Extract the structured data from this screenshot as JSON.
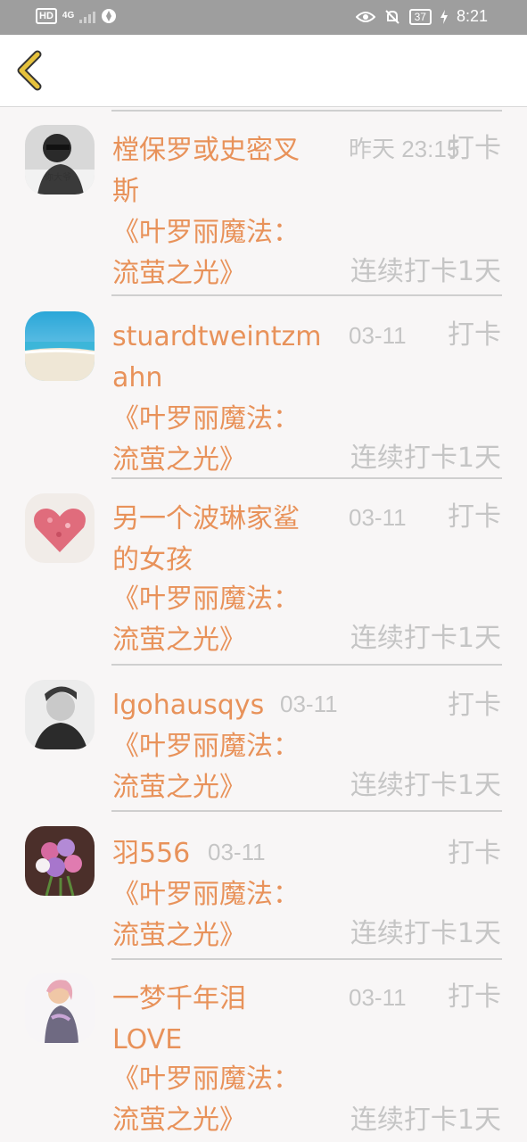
{
  "status_bar": {
    "hd": "HD",
    "network": "4G",
    "battery": "37",
    "time": "8:21",
    "icons": [
      "hd-icon",
      "signal-icon",
      "vpn-icon",
      "eye-icon",
      "mute-icon",
      "battery-icon",
      "charging-icon"
    ]
  },
  "header": {
    "back_icon": "chevron-left-icon"
  },
  "list": [
    {
      "name": "樘保罗或史密叉\n斯",
      "date": "昨天 23:15",
      "checkin": "打卡",
      "book": "《叶罗丽魔法：\n流萤之光》",
      "streak": "连续打卡1天"
    },
    {
      "name": "stuardtweintzm\nahn",
      "date": "03-11",
      "checkin": "打卡",
      "book": "《叶罗丽魔法：\n流萤之光》",
      "streak": "连续打卡1天"
    },
    {
      "name": "另一个波琳家鲨\n的女孩",
      "date": "03-11",
      "checkin": "打卡",
      "book": "《叶罗丽魔法：\n流萤之光》",
      "streak": "连续打卡1天"
    },
    {
      "name": "lgohausqys",
      "date": "03-11",
      "checkin": "打卡",
      "book": "《叶罗丽魔法：\n流萤之光》",
      "streak": "连续打卡1天"
    },
    {
      "name": "羽556",
      "date": "03-11",
      "checkin": "打卡",
      "book": "《叶罗丽魔法：\n流萤之光》",
      "streak": "连续打卡1天"
    },
    {
      "name": "一梦千年泪\nLOVE",
      "date": "03-11",
      "checkin": "打卡",
      "book": "《叶罗丽魔法：\n流萤之光》",
      "streak": "连续打卡1天"
    }
  ],
  "colors": {
    "accent": "#e8925a",
    "muted": "#c5c5c5",
    "back_icon": "#e6c23c",
    "statusbar": "#9e9e9e"
  }
}
